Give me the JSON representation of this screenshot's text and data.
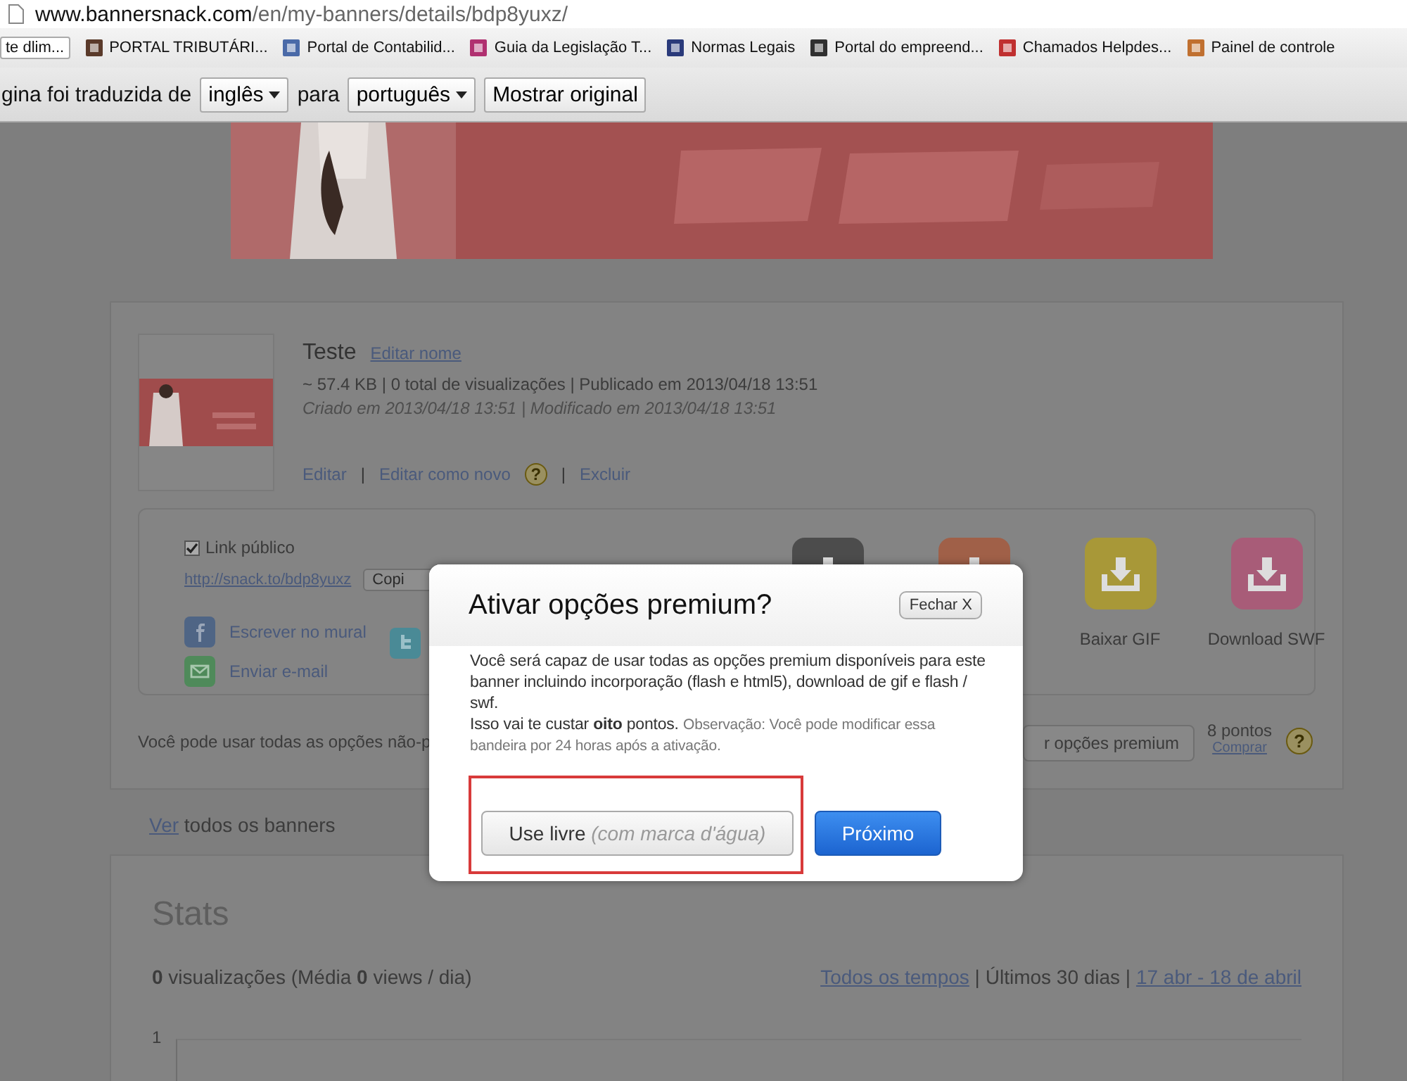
{
  "address_bar": {
    "host": "www.bannersnack.com",
    "path": "/en/my-banners/details/bdp8yuxz/"
  },
  "bookmarks": [
    {
      "label": "te dlim..."
    },
    {
      "label": "PORTAL TRIBUTÁRI...",
      "color": "#5a3a2a"
    },
    {
      "label": "Portal de Contabilid...",
      "color": "#4a6aa8"
    },
    {
      "label": "Guia da Legislação T...",
      "color": "#b03070"
    },
    {
      "label": "Normas Legais",
      "color": "#2a3a7a"
    },
    {
      "label": "Portal do empreend...",
      "color": "#303030"
    },
    {
      "label": "Chamados Helpdes...",
      "color": "#c03030"
    },
    {
      "label": "Painel de controle",
      "color": "#c07030"
    }
  ],
  "translate_bar": {
    "message": "gina foi traduzida de",
    "from": "inglês",
    "to_label": "para",
    "to": "português",
    "show_original": "Mostrar original"
  },
  "details": {
    "title": "Teste",
    "rename_link": "Editar nome",
    "meta": "~ 57.4 KB | 0 total de visualizações | Publicado em 2013/04/18 13:51",
    "dates": "Criado em 2013/04/18 13:51 | Modificado em 2013/04/18 13:51",
    "actions": [
      {
        "kind": "link",
        "label": "Editar"
      },
      {
        "kind": "separator",
        "label": "|"
      },
      {
        "kind": "link",
        "label": "Editar como novo"
      },
      {
        "kind": "help",
        "label": "?"
      },
      {
        "kind": "separator",
        "label": "|"
      },
      {
        "kind": "link",
        "label": "Excluir"
      }
    ]
  },
  "sharing": {
    "public_link": {
      "label": "Link público",
      "checked": true
    },
    "url": "http://snack.to/bdp8yuxz",
    "copy_button": "Copi",
    "social": [
      {
        "kind": "facebook",
        "label": "Escrever no mural"
      },
      {
        "kind": "mail",
        "label": "Enviar e-mail"
      }
    ],
    "tiles": [
      {
        "color": "#4c4c4c"
      },
      {
        "color": "#a06048"
      },
      {
        "color": "#a89838",
        "label": "Baixar GIF"
      },
      {
        "color": "#a85c78",
        "label": "Download SWF"
      }
    ]
  },
  "premium_row": {
    "text": "Você pode usar todas as opções não-p",
    "button": "r opções premium",
    "points": "8 pontos",
    "buy_link": "Comprar",
    "help": "?"
  },
  "view_all": {
    "link": "Ver",
    "text": " todos os banners"
  },
  "stats": {
    "title": "Stats",
    "summary": "**0** visualizações (Média **0** views / dia)",
    "ranges": [
      {
        "kind": "link",
        "label": "Todos os tempos"
      },
      {
        "kind": "separator",
        "label": " | "
      },
      {
        "kind": "text",
        "label": "Últimos 30 dias"
      },
      {
        "kind": "separator",
        "label": " | "
      },
      {
        "kind": "link",
        "label": "17 abr - 18 de abril"
      }
    ],
    "y_tick": "1"
  },
  "dialog": {
    "title": "Ativar opções premium?",
    "close": "Fechar X",
    "body": "Você será capaz de usar todas as opções premium disponíveis para este banner incluindo incorporação (flash e html5), download de gif e flash / swf.",
    "cost": "Isso vai te custar **oito** pontos.",
    "note": "Observação: Você pode modificar essa bandeira por 24 horas após a ativação.",
    "free_button": {
      "label": "Use livre",
      "hint": "(com marca d'água)",
      "highlighted": true
    },
    "next_button": "Próximo"
  }
}
